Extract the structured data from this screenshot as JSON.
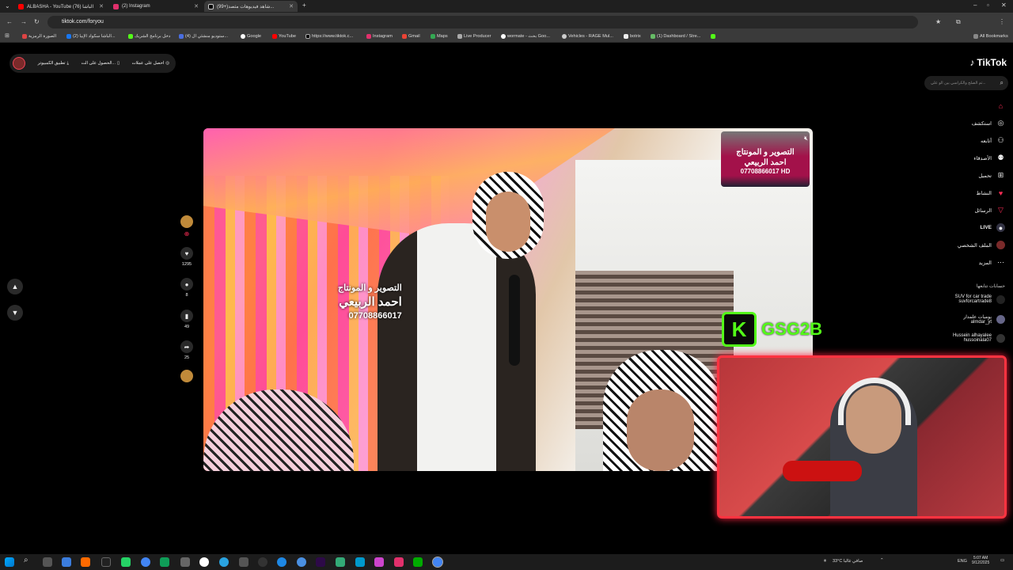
{
  "browser": {
    "tabs": [
      {
        "title": "ALBASHA - YouTube الباشا (76)",
        "active": false,
        "color": "#ff0000"
      },
      {
        "title": "(2) Instagram",
        "active": false,
        "color": "#e1306c"
      },
      {
        "title": "(99+)شاهد فيديوهات مثصد...",
        "active": true,
        "color": "#000000"
      }
    ],
    "url": "tiktok.com/foryou",
    "bookmarks": [
      "الصورة الرمزية",
      "(2) الباشا سكواد الإبيا...",
      "دخل برنامج الشريك",
      "(4) ستوديو منشئي ال...",
      "Google",
      "YouTube",
      "https://www.tiktok.c...",
      "Instagram",
      "Gmail",
      "Maps",
      "Live Producer",
      "wormate - بحث Goo...",
      "Vehicles - RAGE Mul...",
      "botrix",
      "(1) Dashboard / Stre..."
    ],
    "all_bookmarks": "All Bookmarks"
  },
  "tiktok": {
    "logo": "TikTok",
    "search_placeholder": "تم الصلح والكراسي بين الو علي...",
    "top_buttons": [
      "احصل على عملات",
      "الحصول على الت...",
      "تطبيق الكمبيوتر"
    ],
    "nav": [
      {
        "label": "",
        "icon": "home-icon",
        "accent": true
      },
      {
        "label": "استكشف",
        "icon": "compass-icon"
      },
      {
        "label": "أتابعه",
        "icon": "following-icon"
      },
      {
        "label": "الأصدقاء",
        "icon": "friends-icon"
      },
      {
        "label": "تحميل",
        "icon": "upload-icon"
      },
      {
        "label": "النشاط",
        "icon": "activity-icon",
        "badge": "99"
      },
      {
        "label": "الرسائل",
        "icon": "messages-icon",
        "badge": "99"
      },
      {
        "label": "LIVE",
        "icon": "live-icon"
      },
      {
        "label": "الملف الشخصي",
        "icon": "profile-icon"
      },
      {
        "label": "المزيد",
        "icon": "more-icon"
      }
    ],
    "following_title": "حسابات تتابعها",
    "following": [
      {
        "name": "SUV for car trade",
        "handle": "suvforcartrade8"
      },
      {
        "name": "يوميات علمدار",
        "handle": "almdar_yt"
      },
      {
        "name": "Hussein alhayalee",
        "handle": "hussoinala07"
      }
    ],
    "actions": {
      "likes": "1295",
      "comments": "8",
      "saves": "49",
      "shares": "25"
    },
    "video_watermark_1": [
      "التصوير و المونتاج",
      "احمد الربيعي",
      "07708866017"
    ],
    "video_watermark_2": [
      "التصوير و المونتاج",
      "احمد الربيعي",
      "07708866017 HD"
    ]
  },
  "overlay": {
    "channel": "GSG2B",
    "kick_letter": "K"
  },
  "taskbar": {
    "weather": "33°C صافي غالبا",
    "lang": "ENG",
    "time": "5:07 AM",
    "date": "9/12/2025"
  }
}
